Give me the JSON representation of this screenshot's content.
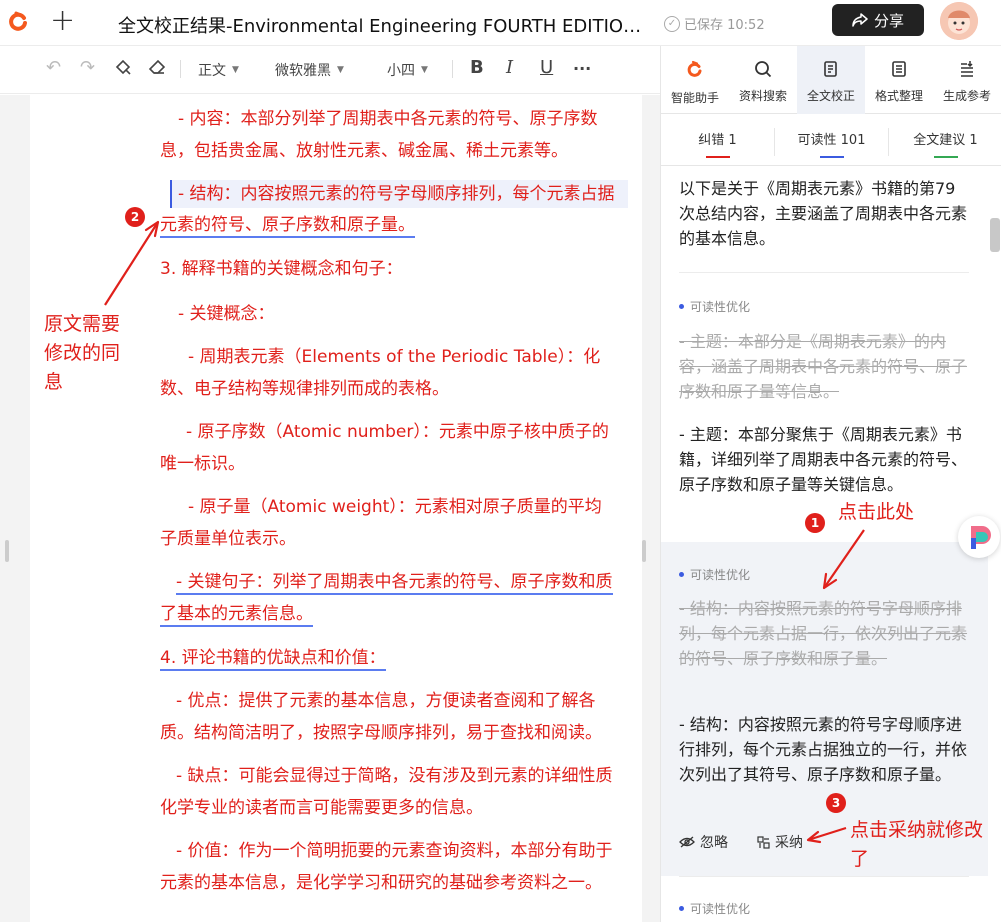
{
  "topbar": {
    "title": "全文校正结果-Environmental Engineering FOURTH EDITION ( ...",
    "saved": "已保存 10:52",
    "share": "分享"
  },
  "toolbar": {
    "style": "正文",
    "font": "微软雅黑",
    "size": "小四",
    "bold": "B",
    "italic": "I",
    "underline": "U",
    "more": "···"
  },
  "document": {
    "lines": [
      "- 内容：本部分列举了周期表中各元素的符号、原子序数",
      "息，包括贵金属、放射性元素、碱金属、稀土元素等。",
      "- 结构：内容按照元素的符号字母顺序排列，每个元素占据",
      "元素的符号、原子序数和原子量。",
      "3. 解释书籍的关键概念和句子：",
      "- 关键概念：",
      "- 周期表元素（Elements of the Periodic Table）：化",
      "数、电子结构等规律排列而成的表格。",
      "- 原子序数（Atomic number）：元素中原子核中质子的",
      "唯一标识。",
      "- 原子量（Atomic weight）：元素相对原子质量的平均",
      "子质量单位表示。",
      "- 关键句子：列举了周期表中各元素的符号、原子序数和质",
      "了基本的元素信息。",
      "4. 评论书籍的优缺点和价值：",
      "- 优点：提供了元素的基本信息，方便读者查阅和了解各",
      "质。结构简洁明了，按照字母顺序排列，易于查找和阅读。",
      "- 缺点：可能会显得过于简略，没有涉及到元素的详细性质",
      "化学专业的读者而言可能需要更多的信息。",
      "- 价值：作为一个简明扼要的元素查询资料，本部分有助于",
      "元素的基本信息，是化学学习和研究的基础参考资料之一。"
    ],
    "annotation_left": "原文需要修改的同息",
    "badge2": "2"
  },
  "panel": {
    "tabs": [
      "智能助手",
      "资料搜索",
      "全文校正",
      "格式整理",
      "生成参考"
    ],
    "subtabs": [
      "纠错 1",
      "可读性 101",
      "全文建议 1"
    ],
    "summary": "以下是关于《周期表元素》书籍的第79次总结内容，主要涵盖了周期表中各元素的基本信息。",
    "card1": {
      "tag": "可读性优化",
      "old": "- 主题：本部分是《周期表元素》的内容，涵盖了周期表中各元素的符号、原子序数和原子量等信息。",
      "new": "- 主题：本部分聚焦于《周期表元素》书籍，详细列举了周期表中各元素的符号、原子序数和原子量等关键信息。"
    },
    "card2": {
      "tag": "可读性优化",
      "old": "- 结构：内容按照元素的符号字母顺序排列，每个元素占据一行，依次列出了元素的符号、原子序数和原子量。",
      "new": "- 结构：内容按照元素的符号字母顺序进行排列，每个元素占据独立的一行，并依次列出了其符号、原子序数和原子量。",
      "ignore": "忽略",
      "accept": "采纳"
    },
    "card3": {
      "tag": "可读性优化"
    },
    "annotation_click": "点击此处",
    "annotation_accept": "点击采纳就修改了",
    "badge1": "1",
    "badge3": "3"
  },
  "colors": {
    "accent_red": "#e0201b",
    "accent_blue": "#3b5be0",
    "logo_orange": "#f4591e"
  },
  "icons": [
    "logo-icon",
    "plus-icon",
    "check-circle-icon",
    "share-icon",
    "avatar",
    "undo-icon",
    "redo-icon",
    "format-brush-icon",
    "eraser-icon",
    "ai-assistant-icon",
    "search-icon",
    "proofread-icon",
    "format-icon",
    "reference-icon",
    "eye-off-icon",
    "accept-icon"
  ]
}
